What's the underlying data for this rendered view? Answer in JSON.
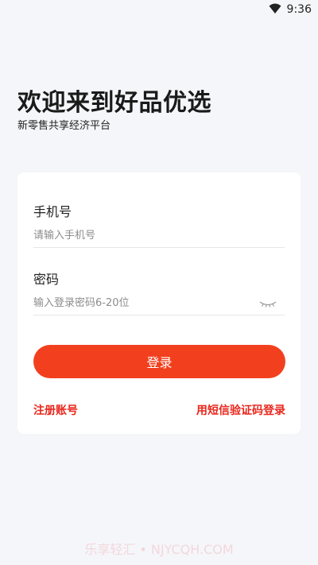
{
  "status_bar": {
    "time": "9:36",
    "wifi_icon": "wifi-icon"
  },
  "header": {
    "title": "欢迎来到好品优选",
    "subtitle": "新零售共享经济平台"
  },
  "login_form": {
    "phone_label": "手机号",
    "phone_placeholder": "请输入手机号",
    "phone_value": "",
    "password_label": "密码",
    "password_placeholder": "输入登录密码6-20位",
    "password_value": "",
    "password_toggle_icon": "eye-closed-icon",
    "login_button_label": "登录",
    "register_link": "注册账号",
    "sms_login_link": "用短信验证码登录"
  },
  "watermark": "乐享轻汇 • NJYCQH.COM",
  "colors": {
    "accent": "#f2401f",
    "link": "#e8261c",
    "background": "#f5f6fa",
    "card": "#ffffff"
  }
}
